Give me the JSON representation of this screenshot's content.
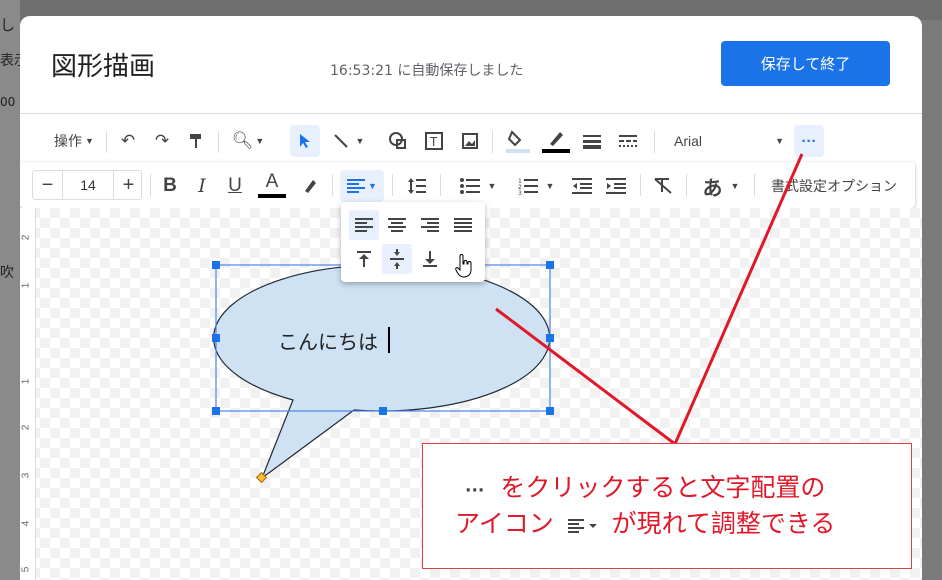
{
  "background": {
    "snippets": [
      "し",
      "表示",
      "00",
      "吹"
    ]
  },
  "dialog": {
    "title": "図形描画",
    "autosave": "16:53:21 に自動保存しました",
    "save_button": "保存して終了"
  },
  "toolbar1": {
    "actions_label": "操作",
    "font_name": "Arial",
    "more_label": "···"
  },
  "toolbar2": {
    "font_size": "14",
    "bold": "B",
    "italic": "I",
    "underline": "U",
    "text_color": "A",
    "input_tools": "あ",
    "format_options": "書式設定オプション"
  },
  "canvas": {
    "ruler_numbers": [
      "2",
      "1",
      "1",
      "2",
      "3",
      "4",
      "5"
    ],
    "shape_text": "こんにちは"
  },
  "annotation": {
    "line1_prefix": "···",
    "line1": "をクリックすると文字配置の",
    "line2_pre": "アイコン",
    "line2_post": "が現れて調整できる"
  },
  "colors": {
    "accent": "#1a73e8",
    "shape_fill": "#cfe2f3",
    "annotation_red": "#e0182a"
  }
}
